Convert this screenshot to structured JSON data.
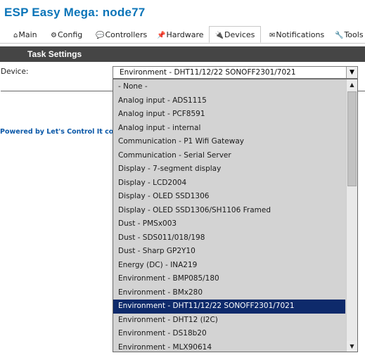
{
  "app": {
    "title": "ESP Easy Mega: node77"
  },
  "tabs": [
    {
      "icon": "⌂",
      "label": "Main"
    },
    {
      "icon": "⚙",
      "label": "Config"
    },
    {
      "icon": "💬",
      "label": "Controllers"
    },
    {
      "icon": "📌",
      "label": "Hardware"
    },
    {
      "icon": "🔌",
      "label": "Devices"
    },
    {
      "icon": "✉",
      "label": "Notifications"
    },
    {
      "icon": "🔧",
      "label": "Tools"
    }
  ],
  "section": {
    "title": "Task Settings"
  },
  "form": {
    "device_label": "Device:",
    "device_value": "Environment - DHT11/12/22 SONOFF2301/7021"
  },
  "footer": {
    "prefix": "Powered by ",
    "link": "Let's Control It",
    "suffix": " commu"
  },
  "options": [
    "- None -",
    "Analog input - ADS1115",
    "Analog input - PCF8591",
    "Analog input - internal",
    "Communication - P1 Wifi Gateway",
    "Communication - Serial Server",
    "Display - 7-segment display",
    "Display - LCD2004",
    "Display - OLED SSD1306",
    "Display - OLED SSD1306/SH1106 Framed",
    "Dust - PMSx003",
    "Dust - SDS011/018/198",
    "Dust - Sharp GP2Y10",
    "Energy (DC) - INA219",
    "Environment - BMP085/180",
    "Environment - BMx280",
    "Environment - DHT11/12/22 SONOFF2301/7021",
    "Environment - DHT12 (I2C)",
    "Environment - DS18b20",
    "Environment - MLX90614"
  ],
  "selected_index": 16,
  "colors": {
    "title": "#0a74b8",
    "header_bg": "#454545",
    "selected_bg": "#0e2a6b"
  }
}
